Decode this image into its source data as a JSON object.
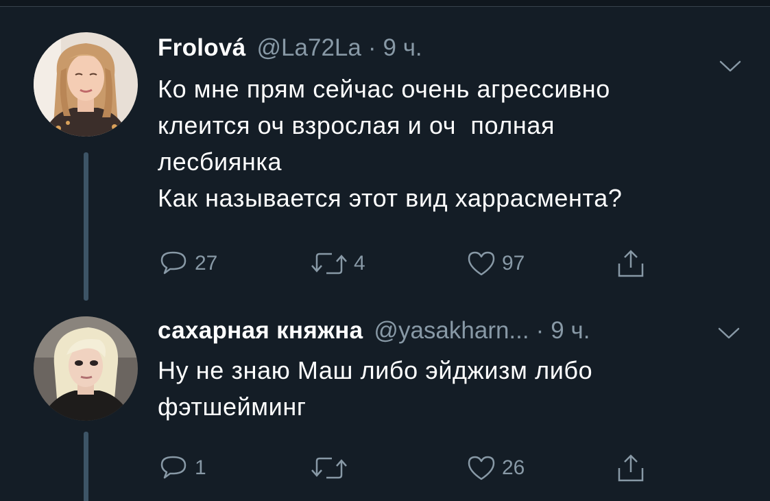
{
  "tweets": [
    {
      "display_name": "Frolová",
      "handle": "@La72La",
      "separator": "·",
      "time": "9 ч.",
      "body": [
        "Ко мне прям сейчас очень агрессивно",
        "клеится оч взрослая и оч  полная",
        "лесбиянка",
        "Как называется этот вид харрасмента?"
      ],
      "replies": "27",
      "retweets": "4",
      "likes": "97"
    },
    {
      "display_name": "сахарная княжна",
      "handle": "@yasakharn...",
      "separator": "·",
      "time": "9 ч.",
      "body": [
        "Ну не знаю Маш либо эйджизм либо",
        "фэтшейминг"
      ],
      "replies": "1",
      "retweets": "",
      "likes": "26"
    }
  ],
  "colors": {
    "background": "#141d26",
    "primary_text": "#ffffff",
    "secondary_text": "#8899a6",
    "thread_line": "#3d5466"
  },
  "icons": {
    "reply": "reply-icon",
    "retweet": "retweet-icon",
    "like": "heart-icon",
    "share": "share-icon",
    "menu": "chevron-down-icon"
  }
}
